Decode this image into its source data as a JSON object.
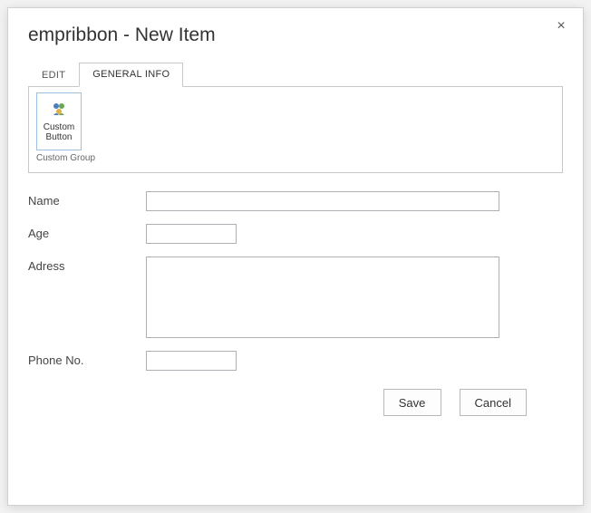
{
  "dialog": {
    "title": "empribbon - New Item",
    "close_glyph": "×"
  },
  "tabs": {
    "edit": "EDIT",
    "general_info": "GENERAL INFO"
  },
  "ribbon": {
    "custom_button_label": "Custom Button",
    "custom_group_label": "Custom Group"
  },
  "form": {
    "name": {
      "label": "Name",
      "value": ""
    },
    "age": {
      "label": "Age",
      "value": ""
    },
    "address": {
      "label": "Adress",
      "value": ""
    },
    "phone": {
      "label": "Phone No.",
      "value": ""
    }
  },
  "buttons": {
    "save": "Save",
    "cancel": "Cancel"
  }
}
